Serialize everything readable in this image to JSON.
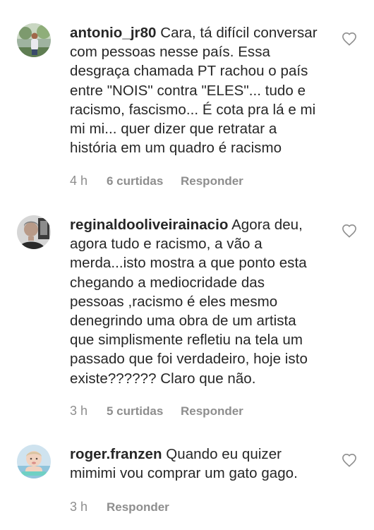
{
  "comments": [
    {
      "username": "antonio_jr80",
      "text": "Cara, tá difícil conversar\ncom pessoas nesse país. Essa\ndesgraça chamada PT rachou o país\nentre \"NOIS\" contra \"ELES\"... tudo e\nracismo, fascismo... É cota pra lá e mi\nmi mi... quer dizer que retratar a\nhistória em um quadro é racismo",
      "time": "4 h",
      "likes": "6 curtidas",
      "reply": "Responder"
    },
    {
      "username": "reginaldooliveirainacio",
      "text": "Agora deu,\nagora tudo e racismo, a vão a\nmerda...isto mostra a que ponto esta\nchegando a mediocridade das\npessoas ,racismo é eles mesmo\ndenegrindo uma obra de um artista\nque simplismente refletiu na tela um\npassado que foi verdadeiro, hoje isto\nexiste?????? Claro que não.",
      "time": "3 h",
      "likes": "5 curtidas",
      "reply": "Responder"
    },
    {
      "username": "roger.franzen",
      "text": "Quando eu quizer\nmimimi vou comprar um gato gago.",
      "time": "3 h",
      "likes": "",
      "reply": "Responder"
    }
  ],
  "icons": {
    "like": "heart-outline-icon"
  },
  "colors": {
    "text": "#262626",
    "meta": "#8e8e8e",
    "background": "#ffffff"
  }
}
